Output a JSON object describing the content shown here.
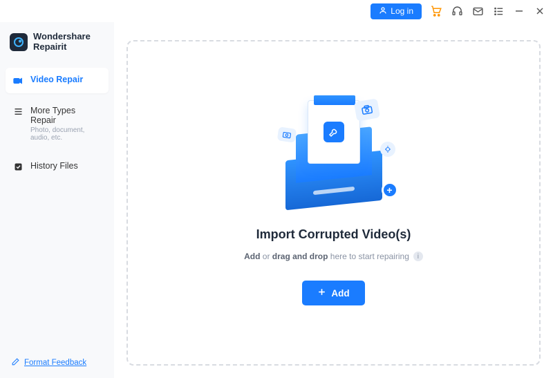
{
  "titlebar": {
    "login_label": "Log in"
  },
  "brand": {
    "name": "Wondershare\nRepairit"
  },
  "sidebar": {
    "items": [
      {
        "label": "Video Repair",
        "icon": "video-camera-icon"
      },
      {
        "label": "More Types Repair",
        "sub": "Photo, document, audio, etc.",
        "icon": "menu-icon"
      },
      {
        "label": "History Files",
        "icon": "check-box-icon"
      }
    ],
    "feedback_label": "Format Feedback"
  },
  "main": {
    "title": "Import Corrupted Video(s)",
    "subtitle_bold1": "Add",
    "subtitle_mid": " or ",
    "subtitle_bold2": "drag and drop",
    "subtitle_tail": " here to start repairing",
    "add_label": "Add"
  },
  "colors": {
    "accent": "#1a7cff"
  }
}
